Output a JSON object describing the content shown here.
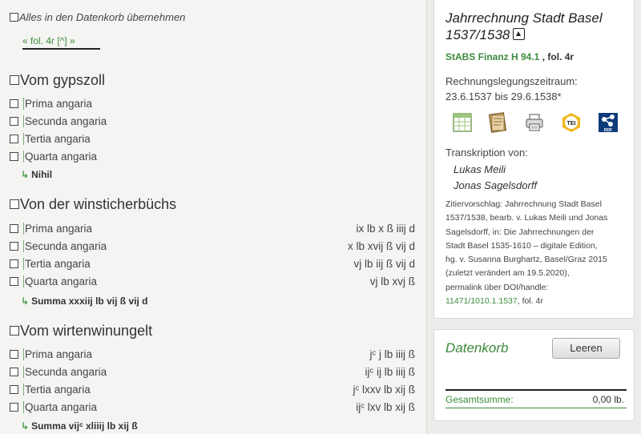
{
  "main": {
    "select_all_label": "Alles in den Datenkorb übernehmen",
    "folio_nav": "« fol. 4r [^] »",
    "sections": [
      {
        "title": "Vom gypszoll",
        "rows": [
          {
            "label": "Prima angaria",
            "value": ""
          },
          {
            "label": "Secunda angaria",
            "value": ""
          },
          {
            "label": "Tertia angaria",
            "value": ""
          },
          {
            "label": "Quarta angaria",
            "value": ""
          }
        ],
        "summary": "Nihil"
      },
      {
        "title": "Von der winsticherbüchs",
        "rows": [
          {
            "label": "Prima angaria",
            "value": "ix lb x ß iiij d"
          },
          {
            "label": "Secunda angaria",
            "value": "x lb xvij ß vij d"
          },
          {
            "label": "Tertia angaria",
            "value": "vj lb iij ß vij d"
          },
          {
            "label": "Quarta angaria",
            "value": "vj lb xvj ß"
          }
        ],
        "summary": "Summa xxxiij lb vij ß vij d"
      },
      {
        "title": "Vom wirtenwinungelt",
        "rows": [
          {
            "label": "Prima angaria",
            "value": "jᶜ j lb iiij ß"
          },
          {
            "label": "Secunda angaria",
            "value": "ijᶜ ij lb iiij ß"
          },
          {
            "label": "Tertia angaria",
            "value": "jᶜ lxxv lb xij ß"
          },
          {
            "label": "Quarta angaria",
            "value": "ijᶜ lxv lb xij ß"
          }
        ],
        "summary": "Summa vijᶜ xliiij lb xij ß"
      }
    ]
  },
  "sidebar": {
    "doc_title_line1": "Jahrrechnung Stadt Basel",
    "doc_title_line2": "1537/1538",
    "signature": "StABS Finanz H 94.1",
    "folio": " , fol. 4r",
    "period_label": "Rechnungslegungszeitraum:",
    "period_value": "23.6.1537 bis 29.6.1538*",
    "icons": [
      "spreadsheet-icon",
      "facsimile-icon",
      "print-icon",
      "tei-icon",
      "rdf-icon"
    ],
    "tei_text": "TEI",
    "rdf_text": "RDF",
    "transcription_label": "Transkription von:",
    "transcribers": [
      "Lukas Meili",
      "Jonas Sagelsdorff"
    ],
    "citation_lines": [
      "Zitiervorschlag: Jahrrechnung Stadt Basel",
      "1537/1538, bearb. v. Lukas Meili und Jonas",
      "Sagelsdorff, in: Die Jahrrechnungen der",
      "Stadt Basel 1535-1610 – digitale Edition,",
      "hg. v. Susanna Burghartz, Basel/Graz 2015",
      "(zuletzt verändert am 19.5.2020),",
      "permalink über DOI/handle:"
    ],
    "citation_link": "11471/1010.1.1537",
    "citation_tail": ", fol. 4r",
    "basket": {
      "title": "Datenkorb",
      "clear_button": "Leeren",
      "total_label": "Gesamtsumme:",
      "total_value": "0,00 lb."
    }
  },
  "colors": {
    "accent_green": "#3d8a3d",
    "background": "#f4f4f2",
    "panel": "#ffffff"
  }
}
